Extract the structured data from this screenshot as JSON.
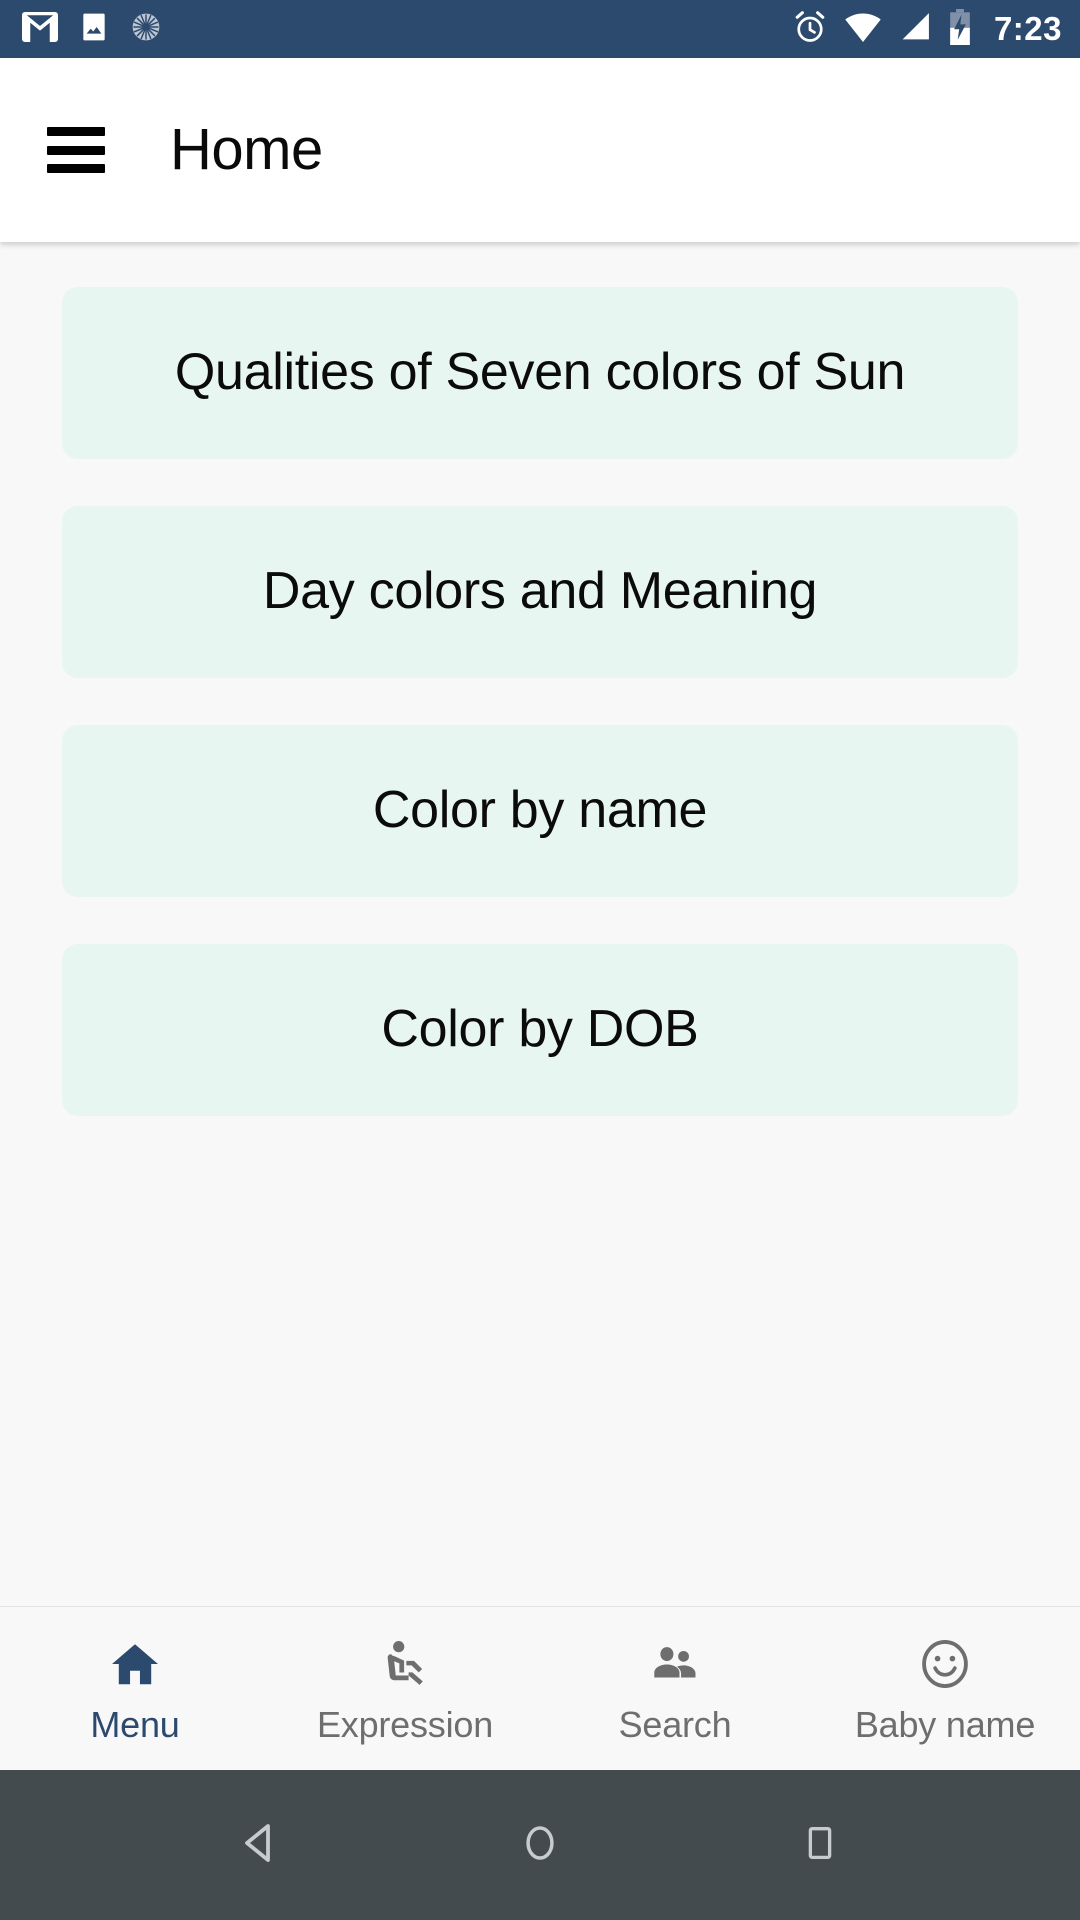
{
  "status_bar": {
    "background_color": "#2C4A6E",
    "left_icons": [
      {
        "name": "gmail-icon",
        "label": "Gmail"
      },
      {
        "name": "photo-icon",
        "label": "Photos"
      },
      {
        "name": "sync-spinner-icon",
        "label": "Syncing"
      }
    ],
    "right_icons": [
      {
        "name": "alarm-icon",
        "label": "Alarm set"
      },
      {
        "name": "wifi-icon",
        "label": "Wi-Fi"
      },
      {
        "name": "cellular-signal-icon",
        "label": "Signal"
      },
      {
        "name": "battery-charging-icon",
        "label": "Battery charging"
      }
    ],
    "time": "7:23"
  },
  "app_bar": {
    "menu_icon": "hamburger-icon",
    "title": "Home",
    "background_color": "#FFFFFF",
    "title_color": "#0A0A0A"
  },
  "main": {
    "background_color": "#F8F8F9",
    "card_color": "#E7F6F1",
    "cards": [
      {
        "label": "Qualities of Seven colors of Sun"
      },
      {
        "label": "Day colors and Meaning"
      },
      {
        "label": "Color by name"
      },
      {
        "label": "Color by DOB"
      }
    ]
  },
  "bottom_nav": {
    "active_color": "#2C4A6E",
    "inactive_color": "#6E6E6E",
    "items": [
      {
        "label": "Menu",
        "icon": "home-icon",
        "active": true
      },
      {
        "label": "Expression",
        "icon": "airline-seat-recline-icon",
        "active": false
      },
      {
        "label": "Search",
        "icon": "people-icon",
        "active": false
      },
      {
        "label": "Baby name",
        "icon": "smiley-face-icon",
        "active": false
      }
    ]
  },
  "system_nav": {
    "background_color": "#444B4F",
    "buttons": [
      {
        "name": "back-button",
        "icon": "triangle-left-icon"
      },
      {
        "name": "home-button",
        "icon": "circle-icon"
      },
      {
        "name": "recents-button",
        "icon": "square-icon"
      }
    ]
  }
}
